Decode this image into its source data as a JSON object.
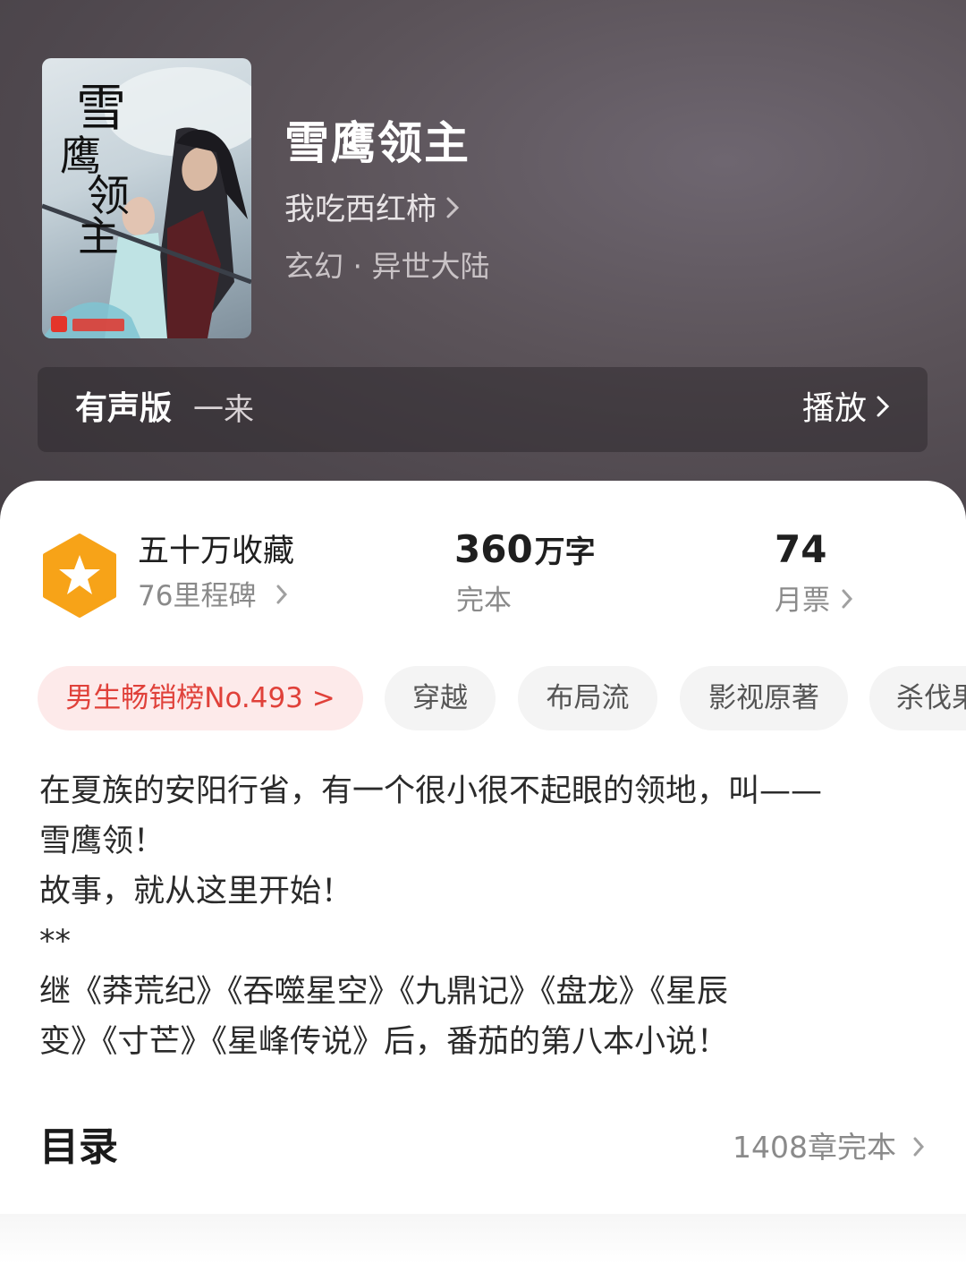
{
  "book": {
    "title": "雪鹰领主",
    "author": "我吃西红柿",
    "genre": "玄幻 · 异世大陆"
  },
  "audio": {
    "label": "有声版",
    "narrator": "一来",
    "play_label": "播放"
  },
  "stats": {
    "collections": "五十万收藏",
    "milestones": "76里程碑",
    "words_number": "360",
    "words_unit": "万字",
    "status": "完本",
    "monthly_tickets": "74",
    "monthly_tickets_label": "月票"
  },
  "tags": [
    "男生畅销榜No.493 >",
    "穿越",
    "布局流",
    "影视原著",
    "杀伐果断"
  ],
  "description": [
    "在夏族的安阳行省，有一个很小很不起眼的领地，叫——",
    "雪鹰领！",
    "故事，就从这里开始！",
    "**",
    "继《莽荒纪》《吞噬星空》《九鼎记》《盘龙》《星辰",
    "变》《寸芒》《星峰传说》后，番茄的第八本小说！"
  ],
  "toc": {
    "title": "目录",
    "summary": "1408章完本"
  },
  "colors": {
    "rank_tag_text": "#e0413a",
    "rank_tag_bg": "#fdeaea",
    "badge_orange": "#f7a318"
  },
  "icons": [
    "star-badge-icon",
    "chevron-right-icon"
  ]
}
